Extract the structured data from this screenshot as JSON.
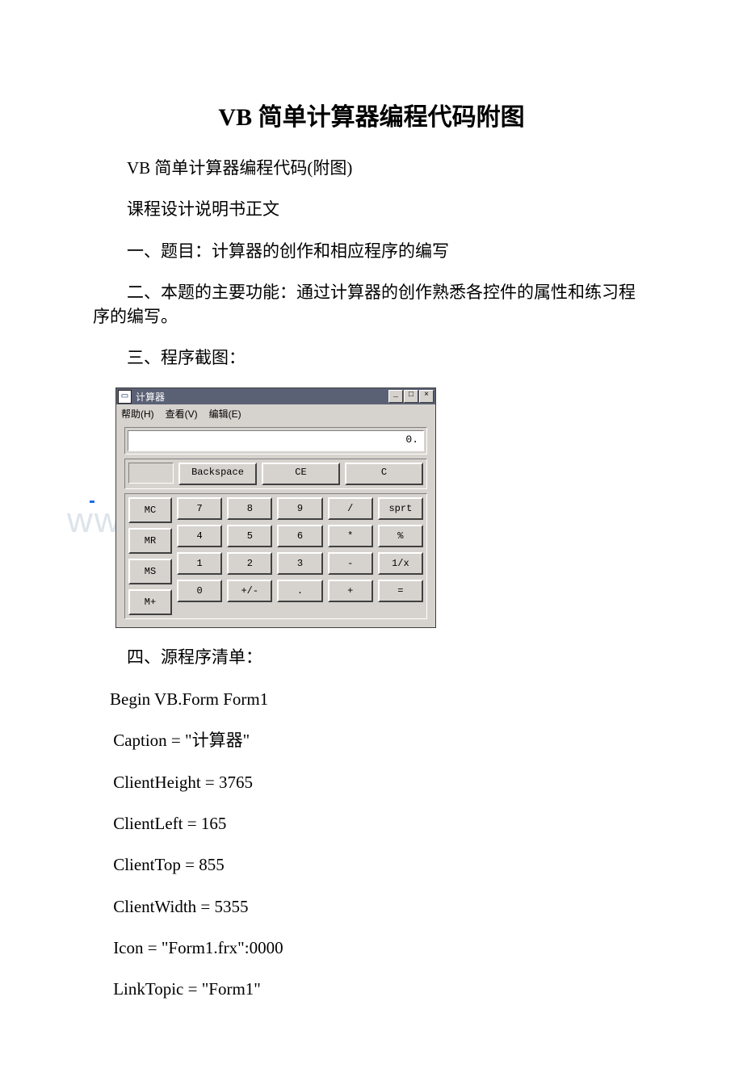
{
  "doc": {
    "title": "VB 简单计算器编程代码附图",
    "paras": {
      "p1": "VB 简单计算器编程代码(附图)",
      "p2": "课程设计说明书正文",
      "p3": "一、题目：计算器的创作和相应程序的编写",
      "p4": "二、本题的主要功能：通过计算器的创作熟悉各控件的属性和练习程序的编写。",
      "p5": "三、程序截图：",
      "p6": "四、源程序清单：",
      "code": {
        "c1": "Begin VB.Form Form1",
        "c2": " Caption = \"计算器\"",
        "c3": " ClientHeight = 3765",
        "c4": " ClientLeft = 165",
        "c5": " ClientTop = 855",
        "c6": " ClientWidth = 5355",
        "c7": " Icon = \"Form1.frx\":0000",
        "c8": " LinkTopic = \"Form1\""
      }
    }
  },
  "calc": {
    "app_icon_glyph": "▭",
    "title": "计算器",
    "win_btns": {
      "min": "_",
      "max": "□",
      "close": "×"
    },
    "menu": {
      "help": "帮助(H)",
      "view": "查看(V)",
      "edit": "编辑(E)"
    },
    "display": "0.",
    "actions": {
      "backspace": "Backspace",
      "ce": "CE",
      "c": "C"
    },
    "mem": {
      "mc": "MC",
      "mr": "MR",
      "ms": "MS",
      "mp": "M+"
    },
    "grid": {
      "r0": {
        "a": "7",
        "b": "8",
        "c": "9",
        "d": "/",
        "e": "sprt"
      },
      "r1": {
        "a": "4",
        "b": "5",
        "c": "6",
        "d": "*",
        "e": "%"
      },
      "r2": {
        "a": "1",
        "b": "2",
        "c": "3",
        "d": "-",
        "e": "1/x"
      },
      "r3": {
        "a": "0",
        "b": "+/-",
        "c": ".",
        "d": "+",
        "e": "="
      }
    }
  },
  "watermark": "www.bdocx.com"
}
